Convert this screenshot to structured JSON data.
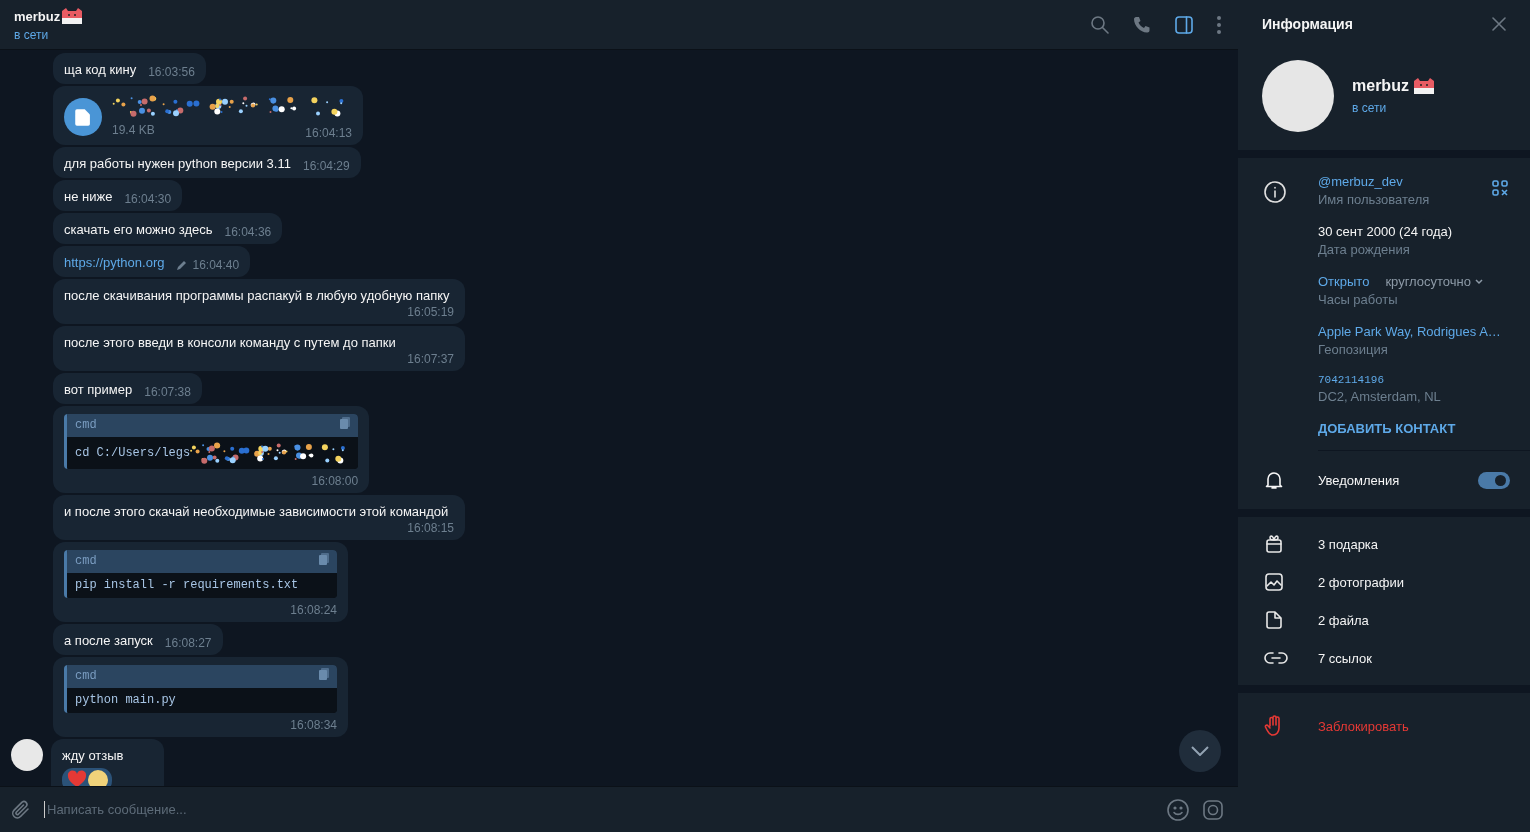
{
  "chat_header": {
    "name": "merbuz",
    "status": "в сети",
    "actions": [
      {
        "kind": "search",
        "selected": false
      },
      {
        "kind": "call",
        "selected": false
      },
      {
        "kind": "sidebar",
        "selected": true
      },
      {
        "kind": "more",
        "selected": false
      }
    ]
  },
  "messages": [
    {
      "kind": "text",
      "text": "ща код кину",
      "time": "16:03:56"
    },
    {
      "kind": "file",
      "size": "19.4 KB",
      "time": "16:04:13"
    },
    {
      "kind": "text",
      "text": "для работы нужен python версии 3.11",
      "time": "16:04:29"
    },
    {
      "kind": "text",
      "text": "не ниже",
      "time": "16:04:30"
    },
    {
      "kind": "text",
      "text": "скачать его можно здесь",
      "time": "16:04:36"
    },
    {
      "kind": "link",
      "text": "https://python.org",
      "time": "16:04:40",
      "edited": true
    },
    {
      "kind": "text",
      "text": "после скачивания программы распакуй в любую удобную папку",
      "time": "16:05:19"
    },
    {
      "kind": "text",
      "text": "после этого введи в консоли команду с путем до папки",
      "time": "16:07:37"
    },
    {
      "kind": "text",
      "text": "вот пример",
      "time": "16:07:38"
    },
    {
      "kind": "code",
      "language": "cmd",
      "code": "cd C:/Users/legs",
      "time": "16:08:00",
      "redacted": true
    },
    {
      "kind": "text",
      "text": "и после этого скачай необходимые зависимости этой командой",
      "time": "16:08:15"
    },
    {
      "kind": "code",
      "language": "cmd",
      "code": "pip install -r requirements.txt",
      "time": "16:08:24",
      "redacted": false
    },
    {
      "kind": "text",
      "text": "а после запуск",
      "time": "16:08:27"
    },
    {
      "kind": "code",
      "language": "cmd",
      "code": "python main.py",
      "time": "16:08:34",
      "redacted": false
    },
    {
      "kind": "reacted",
      "text": "жду отзыв",
      "show_avatar": true
    }
  ],
  "composer": {
    "placeholder": "Написать сообщение..."
  },
  "info_panel": {
    "title": "Информация",
    "name": "merbuz",
    "status": "в сети",
    "details": [
      {
        "kind": "username",
        "value": "@merbuz_dev",
        "label": "Имя пользователя"
      },
      {
        "kind": "text",
        "value": "30 сент 2000 (24 года)",
        "label": "Дата рождения"
      },
      {
        "kind": "hours",
        "value": "Открыто",
        "schedule": "круглосуточно",
        "label": "Часы работы"
      },
      {
        "kind": "link",
        "value": "Apple Park Way, Rodrigues A…",
        "label": "Геопозиция"
      },
      {
        "kind": "id",
        "value": "7042114196",
        "label": "DC2, Amsterdam, NL"
      }
    ],
    "add_contact": "ДОБАВИТЬ КОНТАКТ",
    "notifications": {
      "label": "Уведомления",
      "on": true
    },
    "media": [
      {
        "kind": "gifts",
        "label": "3 подарка"
      },
      {
        "kind": "photos",
        "label": "2 фотографии"
      },
      {
        "kind": "files",
        "label": "2 файла"
      },
      {
        "kind": "links",
        "label": "7 ссылок"
      }
    ],
    "block": "Заблокировать"
  }
}
